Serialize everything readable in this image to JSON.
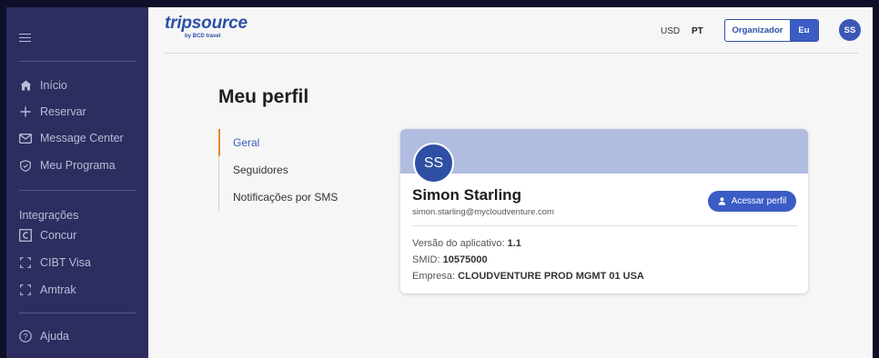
{
  "sidebar": {
    "menu_icon": "hamburger-icon",
    "nav": [
      {
        "label": "Início",
        "icon": "home-icon"
      },
      {
        "label": "Reservar",
        "icon": "plus-icon"
      },
      {
        "label": "Message Center",
        "icon": "mail-icon"
      },
      {
        "label": "Meu Programa",
        "icon": "shield-icon"
      }
    ],
    "integrations_heading": "Integrações",
    "integrations": [
      {
        "label": "Concur",
        "icon": "concur-icon"
      },
      {
        "label": "CIBT Visa",
        "icon": "link-bracket-icon"
      },
      {
        "label": "Amtrak",
        "icon": "link-bracket-icon"
      }
    ],
    "help": {
      "label": "Ajuda",
      "icon": "help-circle-icon"
    }
  },
  "header": {
    "logo_text": "tripsource",
    "logo_sub": "by BCD travel",
    "currency": "USD",
    "language": "PT",
    "toggle": {
      "option_a": "Organizador",
      "option_b": "Eu"
    },
    "avatar_initials": "SS"
  },
  "page": {
    "title": "Meu perfil",
    "subnav": [
      {
        "label": "Geral",
        "active": true
      },
      {
        "label": "Seguidores",
        "active": false
      },
      {
        "label": "Notificações por SMS",
        "active": false
      }
    ]
  },
  "profile": {
    "initials": "SS",
    "name": "Simon Starling",
    "email": "simon.starling@mycloudventure.com",
    "access_button": "Acessar perfil",
    "app_version_label": "Versão do aplicativo:",
    "app_version": "1.1",
    "smid_label": "SMID:",
    "smid": "10575000",
    "company_label": "Empresa:",
    "company": "CLOUDVENTURE PROD MGMT 01 USA"
  },
  "colors": {
    "sidebar_bg": "#2d2d5f",
    "brand_blue": "#3a5cc4",
    "active_accent": "#e8872c",
    "banner": "#b1bde0"
  }
}
